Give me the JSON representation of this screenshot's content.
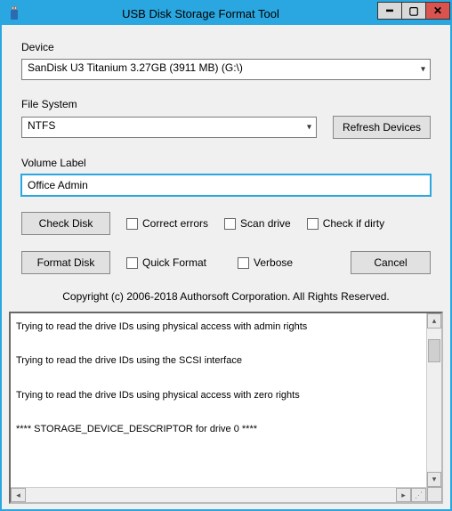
{
  "titlebar": {
    "title": "USB Disk Storage Format Tool"
  },
  "labels": {
    "device": "Device",
    "file_system": "File System",
    "volume_label": "Volume Label"
  },
  "device": {
    "selected": "SanDisk U3 Titanium 3.27GB (3911 MB)  (G:\\)"
  },
  "file_system": {
    "selected": "NTFS"
  },
  "volume_label": {
    "value": "Office Admin"
  },
  "buttons": {
    "refresh": "Refresh Devices",
    "check_disk": "Check Disk",
    "format_disk": "Format Disk",
    "cancel": "Cancel"
  },
  "checkboxes": {
    "correct_errors": "Correct errors",
    "scan_drive": "Scan drive",
    "check_if_dirty": "Check if dirty",
    "quick_format": "Quick Format",
    "verbose": "Verbose"
  },
  "copyright": "Copyright (c) 2006-2018 Authorsoft Corporation. All Rights Reserved.",
  "log": {
    "lines": [
      "Trying to read the drive IDs using physical access with admin rights",
      "Trying to read the drive IDs using the SCSI interface",
      "Trying to read the drive IDs using physical access with zero rights",
      "**** STORAGE_DEVICE_DESCRIPTOR for drive 0 ****"
    ]
  }
}
